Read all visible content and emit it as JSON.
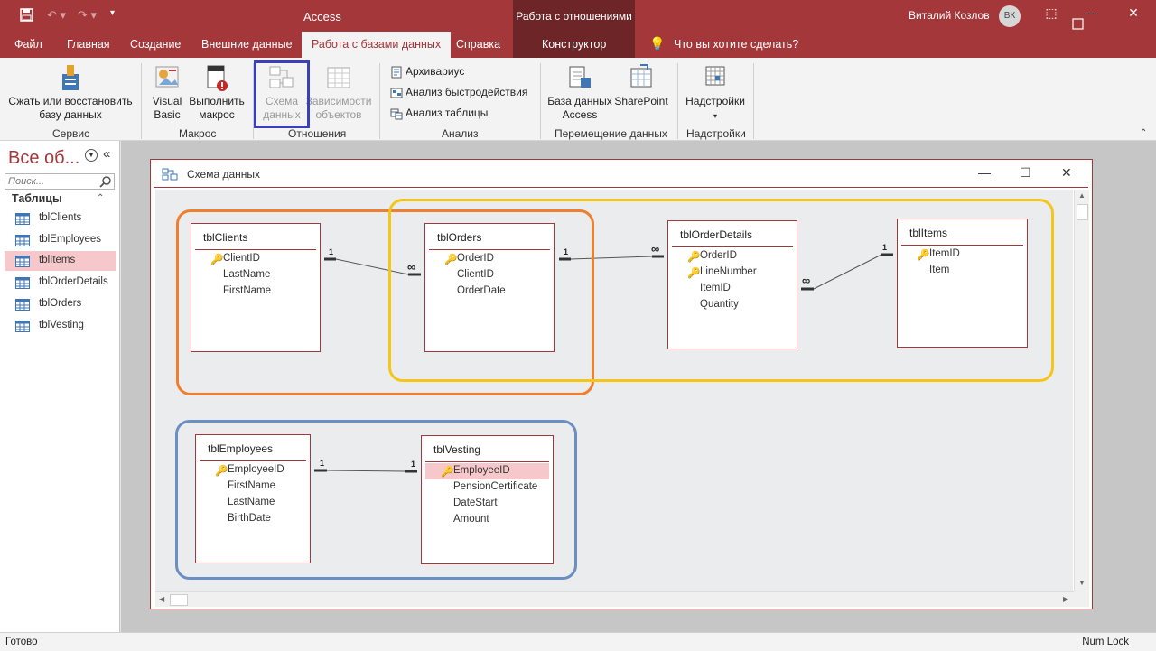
{
  "window": {
    "app_title": "Access",
    "context_title": "Работа с отношениями",
    "user_name": "Виталий Козлов",
    "user_initials": "ВК",
    "controls": {
      "minimize": "—",
      "restore": "☐",
      "close": "✕",
      "ribbon_display": "⬚"
    }
  },
  "tabs": [
    {
      "label": "Файл"
    },
    {
      "label": "Главная"
    },
    {
      "label": "Создание"
    },
    {
      "label": "Внешние данные"
    },
    {
      "label": "Работа с базами данных"
    },
    {
      "label": "Справка"
    },
    {
      "label": "Конструктор"
    }
  ],
  "tell_me": "Что вы хотите сделать?",
  "ribbon": {
    "service": {
      "compact_l1": "Сжать или восстановить",
      "compact_l2": "базу данных",
      "group": "Сервис"
    },
    "macro": {
      "vb_l1": "Visual",
      "vb_l2": "Basic",
      "run_l1": "Выполнить",
      "run_l2": "макрос",
      "group": "Макрос"
    },
    "relations": {
      "schema_l1": "Схема",
      "schema_l2": "данных",
      "deps_l1": "Зависимости",
      "deps_l2": "объектов",
      "group": "Отношения"
    },
    "analysis": {
      "archiver": "Архивариус",
      "perf": "Анализ быстродействия",
      "table": "Анализ таблицы",
      "group": "Анализ"
    },
    "move": {
      "db_l1": "База данных",
      "db_l2": "Access",
      "sp": "SharePoint",
      "group": "Перемещение данных"
    },
    "addins": {
      "label": "Надстройки",
      "group": "Надстройки"
    }
  },
  "nav": {
    "title": "Все об...",
    "search_placeholder": "Поиск...",
    "section": "Таблицы",
    "items": [
      {
        "label": "tblClients",
        "selected": false
      },
      {
        "label": "tblEmployees",
        "selected": false
      },
      {
        "label": "tblItems",
        "selected": true
      },
      {
        "label": "tblOrderDetails",
        "selected": false
      },
      {
        "label": "tblOrders",
        "selected": false
      },
      {
        "label": "tblVesting",
        "selected": false
      }
    ]
  },
  "schema_window": {
    "title": "Схема данных"
  },
  "tables": {
    "clients": {
      "name": "tblClients",
      "fields": [
        {
          "name": "ClientID",
          "key": true
        },
        {
          "name": "LastName",
          "key": false
        },
        {
          "name": "FirstName",
          "key": false
        }
      ]
    },
    "orders": {
      "name": "tblOrders",
      "fields": [
        {
          "name": "OrderID",
          "key": true
        },
        {
          "name": "ClientID",
          "key": false
        },
        {
          "name": "OrderDate",
          "key": false
        }
      ]
    },
    "orderdetails": {
      "name": "tblOrderDetails",
      "fields": [
        {
          "name": "OrderID",
          "key": true
        },
        {
          "name": "LineNumber",
          "key": true
        },
        {
          "name": "ItemID",
          "key": false
        },
        {
          "name": "Quantity",
          "key": false
        }
      ]
    },
    "items": {
      "name": "tblItems",
      "fields": [
        {
          "name": "ItemID",
          "key": true
        },
        {
          "name": "Item",
          "key": false
        }
      ]
    },
    "employees": {
      "name": "tblEmployees",
      "fields": [
        {
          "name": "EmployeeID",
          "key": true
        },
        {
          "name": "FirstName",
          "key": false
        },
        {
          "name": "LastName",
          "key": false
        },
        {
          "name": "BirthDate",
          "key": false
        }
      ]
    },
    "vesting": {
      "name": "tblVesting",
      "fields": [
        {
          "name": "EmployeeID",
          "key": true,
          "highlighted": true
        },
        {
          "name": "PensionCertificate",
          "key": false
        },
        {
          "name": "DateStart",
          "key": false
        },
        {
          "name": "Amount",
          "key": false
        }
      ]
    }
  },
  "relationships": [
    {
      "from": "tblClients.ClientID",
      "to": "tblOrders.ClientID",
      "from_card": "1",
      "to_card": "∞"
    },
    {
      "from": "tblOrders.OrderID",
      "to": "tblOrderDetails.OrderID",
      "from_card": "1",
      "to_card": "∞"
    },
    {
      "from": "tblItems.ItemID",
      "to": "tblOrderDetails.ItemID",
      "from_card": "1",
      "to_card": "∞"
    },
    {
      "from": "tblEmployees.EmployeeID",
      "to": "tblVesting.EmployeeID",
      "from_card": "1",
      "to_card": "1"
    }
  ],
  "highlight_colors": {
    "orange": "#ef7f2f",
    "yellow": "#f5c518",
    "blue": "#6b8fc2",
    "ribbon_highlight": "#3b3fb8"
  },
  "status": {
    "left": "Готово",
    "right": "Num Lock"
  }
}
